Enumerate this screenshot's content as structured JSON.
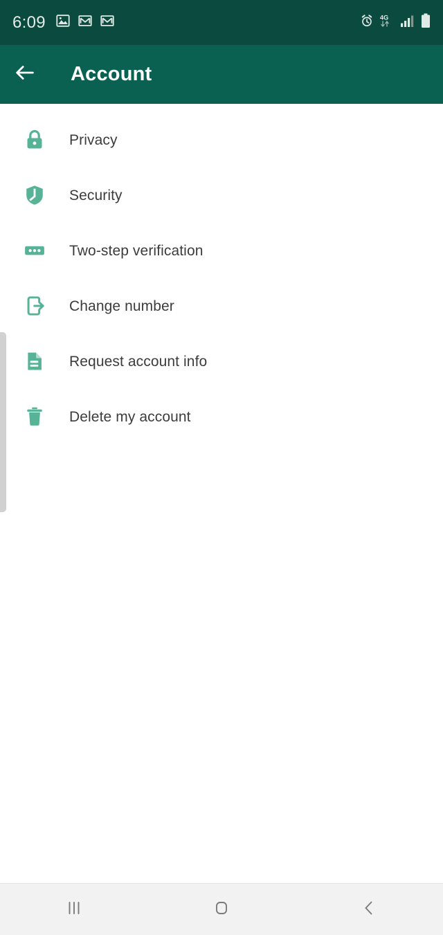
{
  "status_bar": {
    "time": "6:09",
    "left_icons": [
      {
        "name": "photos-icon",
        "label": "Photos"
      },
      {
        "name": "gmail-icon",
        "label": "Gmail"
      },
      {
        "name": "gmail-icon-2",
        "label": "Gmail"
      }
    ],
    "right_icons": [
      {
        "name": "alarm-icon",
        "label": "Alarm"
      },
      {
        "name": "mobile-data-icon",
        "label": "4G"
      },
      {
        "name": "signal-icon",
        "label": "Signal"
      },
      {
        "name": "battery-icon",
        "label": "Battery"
      }
    ],
    "network_type": "4G",
    "background_color": "#0a4a3f"
  },
  "toolbar": {
    "title": "Account",
    "back_icon": "arrow-left-icon",
    "background_color": "#0b6151",
    "title_color": "#ffffff"
  },
  "settings": {
    "accent_color": "#56b396",
    "items": [
      {
        "label": "Privacy",
        "icon": "lock-icon"
      },
      {
        "label": "Security",
        "icon": "shield-icon"
      },
      {
        "label": "Two-step verification",
        "icon": "password-dots-icon"
      },
      {
        "label": "Change number",
        "icon": "phone-exit-icon"
      },
      {
        "label": "Request account info",
        "icon": "document-icon"
      },
      {
        "label": "Delete my account",
        "icon": "trash-icon"
      }
    ]
  },
  "nav_bar": {
    "background_color": "#f2f2f2",
    "buttons": [
      {
        "name": "recents-button",
        "label": "Recents",
        "icon": "recents-icon"
      },
      {
        "name": "home-button",
        "label": "Home",
        "icon": "home-icon"
      },
      {
        "name": "back-nav-button",
        "label": "Back",
        "icon": "chevron-left-icon"
      }
    ]
  }
}
